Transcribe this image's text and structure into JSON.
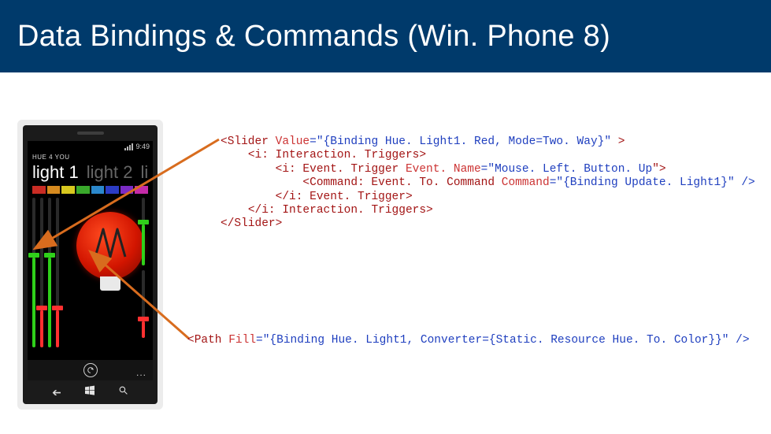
{
  "header": {
    "title": "Data Bindings & Commands (Win. Phone 8)"
  },
  "phone": {
    "status_time": "9:49",
    "app_title": "HUE 4 YOU",
    "tabs": [
      "light 1",
      "light 2",
      "li"
    ],
    "swatch_colors": [
      "#c92c24",
      "#d68a1f",
      "#d8c81f",
      "#39a82b",
      "#2b88cc",
      "#2b3cc4",
      "#7a2bc4",
      "#c42ba8"
    ],
    "appbar_dots": "..."
  },
  "code_block_1": {
    "slider_open_left": "<Slider ",
    "slider_value_attr": "Value",
    "eq_quote1": "=\"{",
    "binding1": "Binding ",
    "path1": "Hue. Light1. Red",
    "comma_mode": ", Mode=",
    "mode_val": "Two. Way",
    "close_brace_quote1": "}\" ",
    "gt1": ">",
    "inter_open": "<i: Interaction. Triggers>",
    "evtrig_open_left": "<i: Event. Trigger ",
    "evtrig_attr": "Event. Name",
    "evtrig_eq": "=\"",
    "evtrig_val": "Mouse. Left. Button. Up",
    "evtrig_close_qgt": "\">",
    "cmd_left": "<Command: Event. To. Command ",
    "cmd_attr": "Command",
    "cmd_eq": "=\"{",
    "cmd_bind": "Binding ",
    "cmd_val": "Update. Light1",
    "cmd_close": "}\" />",
    "evtrig_close": "</i: Event. Trigger>",
    "inter_close": "</i: Interaction. Triggers>",
    "slider_close": "</Slider>"
  },
  "code_block_2": {
    "path_open": "<Path ",
    "fill_attr": "Fill",
    "eq_quote": "=\"{",
    "binding": "Binding ",
    "bind_path": "Hue. Light1",
    "comma_conv": ", Converter={",
    "static_res": "Static. Resource ",
    "conv_name": "Hue. To. Color",
    "close": "}}\" />"
  }
}
